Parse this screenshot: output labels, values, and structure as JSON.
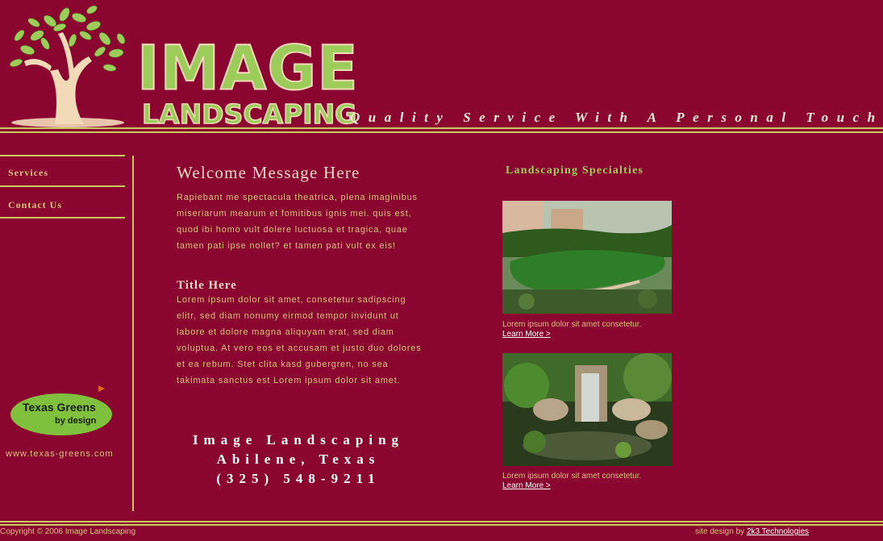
{
  "header": {
    "logo_word1": "IMAGE",
    "logo_word2": "LANDSCAPING",
    "tagline": "Quality Service With A Personal Touch!"
  },
  "sidebar": {
    "items": [
      {
        "label": "Services"
      },
      {
        "label": "Contact Us"
      }
    ],
    "partner_logo_line1": "Texas Greens",
    "partner_logo_line2": "by design",
    "partner_url": "www.texas-greens.com"
  },
  "main": {
    "welcome_title": "Welcome Message Here",
    "welcome_text": "Rapiebant me spectacula theatrica, plena imaginibus miseriarum mearum et fomitibus ignis mei. quis est, quod ibi homo vult dolere luctuosa et tragica, quae tamen pati ipse nollet? et tamen pati vult ex eis!",
    "section_title": "Title Here",
    "section_text": "Lorem ipsum dolor sit amet, consetetur sadipscing elitr, sed diam nonumy eirmod tempor invidunt ut labore et dolore magna aliquyam erat, sed diam voluptua. At vero eos et accusam et justo duo dolores et ea rebum. Stet clita kasd gubergren, no sea takimata sanctus est Lorem ipsum dolor sit amet.",
    "contact_name": "Image Landscaping",
    "contact_city": "Abilene, Texas",
    "contact_phone": "(325) 548-9211"
  },
  "specialties": {
    "title": "Landscaping Specialties",
    "items": [
      {
        "caption": "Lorem ipsum dolor sit amet consetetur.",
        "link": "Learn More >"
      },
      {
        "caption": "Lorem ipsum dolor sit amet consetetur.",
        "link": "Learn More >"
      }
    ]
  },
  "footer": {
    "copyright": "Copyright © 2006 Image Landscaping",
    "credit_prefix": "site design by",
    "credit_link": "2k3 Technologies"
  },
  "colors": {
    "background": "#8a0530",
    "accent_green": "#9ccc5a",
    "rule": "#c9c862",
    "text": "#d6c67a"
  }
}
